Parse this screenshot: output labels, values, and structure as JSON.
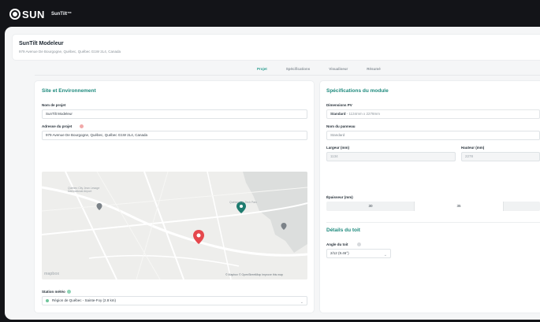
{
  "brand": {
    "logo_text": "SUN",
    "app_title": "SunTilt™"
  },
  "header": {
    "title": "SunTilt Modeleur",
    "address": "979 Avenue De Bourgogne, Québec, Québec G1W 2L4, Canada"
  },
  "tabs": [
    {
      "label": "Projet",
      "active": true
    },
    {
      "label": "Spécifications",
      "active": false
    },
    {
      "label": "Visualiseur",
      "active": false
    },
    {
      "label": "Résumé",
      "active": false
    }
  ],
  "site": {
    "section_title": "Site et Environnement",
    "project_name_label": "Nom de projet",
    "project_name_value": "SunTilt Modeleur",
    "address_label": "Adresse du projet",
    "address_value": "979 Avenue De Bourgogne, Québec, Québec G1W 2L4, Canada",
    "map": {
      "place_labels": [
        "Québec Ctr. Tech Parc",
        "Québec City Jean Lesage International Airport"
      ],
      "attribution": "© Mapbox © OpenStreetMap  Improve this map",
      "logo": "mapbox"
    },
    "station_label": "Station météo",
    "station_value": "Région de Québec - Sainte-Foy (2.8 km)"
  },
  "module": {
    "section_title": "Spécifications du module",
    "dimensions_label": "Dimensions PV",
    "dimensions_value_bold": "Standard",
    "dimensions_value_rest": " - 1134mm x 2278mm",
    "panel_name_label": "Nom du panneau",
    "panel_name_value": "Standard",
    "width_label": "Largeur (mm)",
    "width_value": "1134",
    "height_label": "Hauteur (mm)",
    "height_value": "2278",
    "thickness_label": "Épaisseur (mm)",
    "thickness_options": [
      "30",
      "35"
    ],
    "thickness_selected": "35"
  },
  "roof": {
    "section_title": "Détails du toit",
    "angle_label": "Angle du toit",
    "angle_value": "2/12 (9.46°)"
  },
  "colors": {
    "accent": "#2a9d8f",
    "pin_red": "#e5484d",
    "pin_green": "#1e7b6f"
  }
}
